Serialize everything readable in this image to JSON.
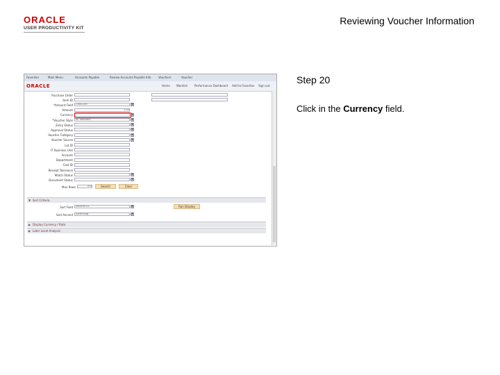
{
  "header": {
    "logo_top": "ORACLE",
    "logo_bottom": "USER PRODUCTIVITY KIT",
    "title": "Reviewing Voucher Information"
  },
  "instructions": {
    "step": "Step 20",
    "prefix": "Click in the ",
    "field": "Currency",
    "suffix": " field."
  },
  "app": {
    "nav": [
      "Favorites",
      "Main Menu",
      "Accounts Payable",
      "Review Accounts Payable Info",
      "Vouchers",
      "Voucher"
    ],
    "brand": "ORACLE",
    "links": [
      "Home",
      "Worklist",
      "Performance Dashboard",
      "Add to Favorites",
      "Sign out"
    ],
    "fields": [
      {
        "label": "Purchase Order",
        "value": ""
      },
      {
        "label": "Item ID",
        "value": ""
      },
      {
        "label": "*Amount Field",
        "value": "Gross Am"
      },
      {
        "label": "Amount",
        "value": "1.00"
      },
      {
        "label": "Currency",
        "value": ""
      },
      {
        "label": "*Voucher Style",
        "value": "All Vouchers"
      },
      {
        "label": "Entry Status",
        "value": ""
      },
      {
        "label": "Approval Status",
        "value": ""
      },
      {
        "label": "Voucher Category",
        "value": ""
      },
      {
        "label": "Voucher Source",
        "value": ""
      },
      {
        "label": "Lot ID",
        "value": ""
      },
      {
        "label": "IT Business Unit",
        "value": ""
      },
      {
        "label": "Account",
        "value": ""
      },
      {
        "label": "Department",
        "value": ""
      },
      {
        "label": "Cost ID",
        "value": ""
      },
      {
        "label": "Receipt Tolerance",
        "value": ""
      },
      {
        "label": "Match Status",
        "value": ""
      },
      {
        "label": "Document Status",
        "value": ""
      }
    ],
    "max_rows_label": "Max Rows",
    "max_rows_value": "300",
    "search_label": "Search",
    "clear_label": "Clear",
    "sort_section": "Sort Criteria",
    "sort_field_label": "Sort Field",
    "sort_field_value": "Voucher ID",
    "sort_remember_label": "Sort Ascend",
    "sort_remember_value": "Ascending",
    "run_display_label": "Run Display",
    "display_section": "Display Currency / Rate",
    "lower_section": "Later Level Analysis"
  }
}
